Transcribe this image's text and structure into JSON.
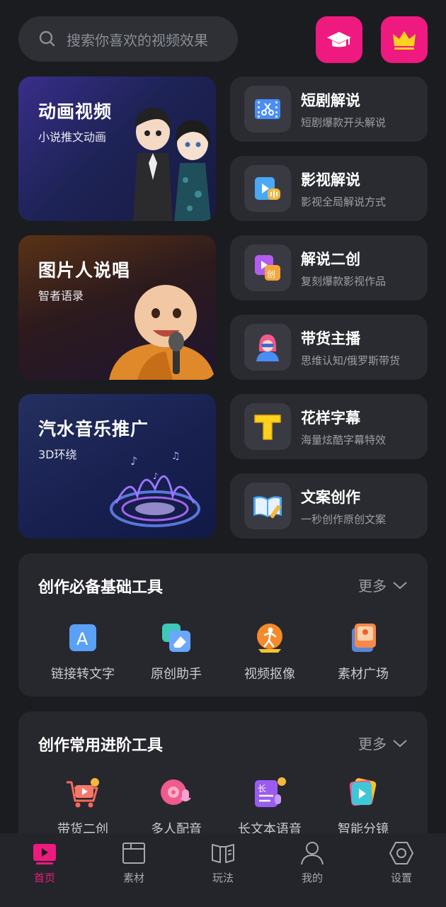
{
  "search": {
    "placeholder": "搜索你喜欢的视频效果"
  },
  "top_buttons": [
    {
      "icon": "graduation-cap-icon"
    },
    {
      "icon": "crown-icon"
    }
  ],
  "feature_cards": [
    {
      "title": "动画视频",
      "subtitle": "小说推文动画"
    },
    {
      "title": "图片人说唱",
      "subtitle": "智者语录"
    },
    {
      "title": "汽水音乐推广",
      "subtitle": "3D环绕"
    }
  ],
  "list_cards": [
    {
      "title": "短剧解说",
      "subtitle": "短剧爆款开头解说",
      "icon": "film-scissors-icon"
    },
    {
      "title": "影视解说",
      "subtitle": "影视全局解说方式",
      "icon": "video-voice-icon"
    },
    {
      "title": "解说二创",
      "subtitle": "复刻爆款影视作品",
      "icon": "recreate-icon"
    },
    {
      "title": "带货主播",
      "subtitle": "思维认知/俄罗斯带货",
      "icon": "anchor-avatar-icon"
    },
    {
      "title": "花样字幕",
      "subtitle": "海量炫酷字幕特效",
      "icon": "letter-t-icon"
    },
    {
      "title": "文案创作",
      "subtitle": "一秒创作原创文案",
      "icon": "open-book-pen-icon"
    }
  ],
  "basic_tools": {
    "title": "创作必备基础工具",
    "more": "更多",
    "items": [
      {
        "label": "链接转文字",
        "icon": "link-to-text-icon"
      },
      {
        "label": "原创助手",
        "icon": "eraser-icon"
      },
      {
        "label": "视频抠像",
        "icon": "person-cutout-icon"
      },
      {
        "label": "素材广场",
        "icon": "image-stack-icon"
      }
    ]
  },
  "advanced_tools": {
    "title": "创作常用进阶工具",
    "more": "更多",
    "items": [
      {
        "label": "带货二创",
        "icon": "shopping-cart-icon"
      },
      {
        "label": "多人配音",
        "icon": "dubbing-icon"
      },
      {
        "label": "长文本语音",
        "icon": "long-text-voice-icon"
      },
      {
        "label": "智能分镜",
        "icon": "storyboard-icon"
      }
    ]
  },
  "nav": [
    {
      "label": "首页",
      "icon": "home-play-icon",
      "active": true
    },
    {
      "label": "素材",
      "icon": "folder-icon"
    },
    {
      "label": "玩法",
      "icon": "book-icon"
    },
    {
      "label": "我的",
      "icon": "person-icon"
    },
    {
      "label": "设置",
      "icon": "settings-hexagon-icon"
    }
  ],
  "colors": {
    "accent": "#ee1a7f",
    "background": "#1b1c20",
    "card": "#2a2b31"
  }
}
